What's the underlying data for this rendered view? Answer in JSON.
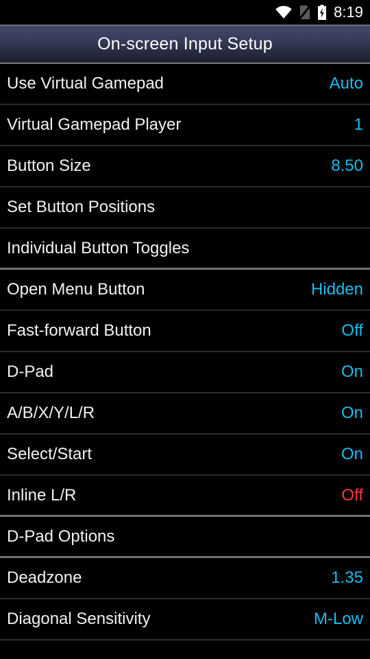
{
  "status_bar": {
    "time": "8:19",
    "icons": [
      {
        "name": "wifi-icon",
        "label": "wifi"
      },
      {
        "name": "no-sim-icon",
        "label": "no sim card"
      },
      {
        "name": "battery-charging-icon",
        "label": "battery charging"
      }
    ]
  },
  "title_bar": {
    "title": "On-screen Input Setup"
  },
  "colors": {
    "accent_blue": "#17bef0",
    "accent_red": "#f8373f",
    "label": "#f2f2f2",
    "background": "#000000",
    "divider": "#2b2b2b",
    "section_divider": "#6f6f6f",
    "titlebar_top": "#43486a",
    "titlebar_bottom": "#1b1d2a"
  },
  "settings_list": [
    {
      "label": "Use Virtual Gamepad",
      "value": "Auto",
      "value_color": "blue",
      "section_end": false
    },
    {
      "label": "Virtual Gamepad Player",
      "value": "1",
      "value_color": "blue",
      "section_end": false
    },
    {
      "label": "Button Size",
      "value": "8.50",
      "value_color": "blue",
      "section_end": false
    },
    {
      "label": "Set Button Positions",
      "value": "",
      "value_color": "none",
      "section_end": false
    },
    {
      "label": "Individual Button Toggles",
      "value": "",
      "value_color": "none",
      "section_end": true
    },
    {
      "label": "Open Menu Button",
      "value": "Hidden",
      "value_color": "blue",
      "section_end": false
    },
    {
      "label": "Fast-forward Button",
      "value": "Off",
      "value_color": "blue",
      "section_end": false
    },
    {
      "label": "D-Pad",
      "value": "On",
      "value_color": "blue",
      "section_end": false
    },
    {
      "label": "A/B/X/Y/L/R",
      "value": "On",
      "value_color": "blue",
      "section_end": false
    },
    {
      "label": "Select/Start",
      "value": "On",
      "value_color": "blue",
      "section_end": false
    },
    {
      "label": "Inline L/R",
      "value": "Off",
      "value_color": "red",
      "section_end": true
    },
    {
      "label": "D-Pad Options",
      "value": "",
      "value_color": "none",
      "section_end": true
    },
    {
      "label": "Deadzone",
      "value": "1.35",
      "value_color": "blue",
      "section_end": false
    },
    {
      "label": "Diagonal Sensitivity",
      "value": "M-Low",
      "value_color": "blue",
      "section_end": false
    }
  ]
}
